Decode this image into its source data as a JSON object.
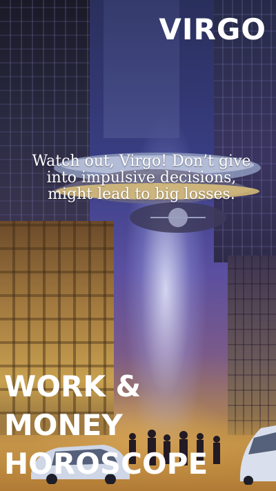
{
  "sign": "VIRGO",
  "message": "Watch out, Virgo! Don’t give into impulsive decisions, might lead to big losses.",
  "heading": {
    "line1": "WORK &",
    "line2": "MONEY",
    "line3": "HOROSCOPE"
  }
}
